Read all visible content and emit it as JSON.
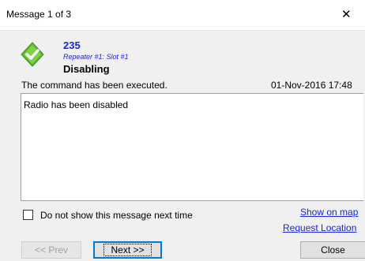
{
  "window": {
    "title": "Message 1 of 3",
    "close_glyph": "✕"
  },
  "message": {
    "id": "235",
    "source": "Repeater #1: Slot #1",
    "title": "Disabling",
    "status": "The command has been executed.",
    "timestamp": "01-Nov-2016 17:48",
    "body": "Radio has been disabled",
    "icon": "check-shield-icon",
    "icon_color": "#5cb82f"
  },
  "options": {
    "dont_show_label": "Do not show this message next time",
    "dont_show_checked": false
  },
  "links": {
    "show_on_map": "Show on map",
    "request_location": "Request Location"
  },
  "buttons": {
    "prev": "<< Prev",
    "next": "Next >>",
    "close": "Close"
  }
}
